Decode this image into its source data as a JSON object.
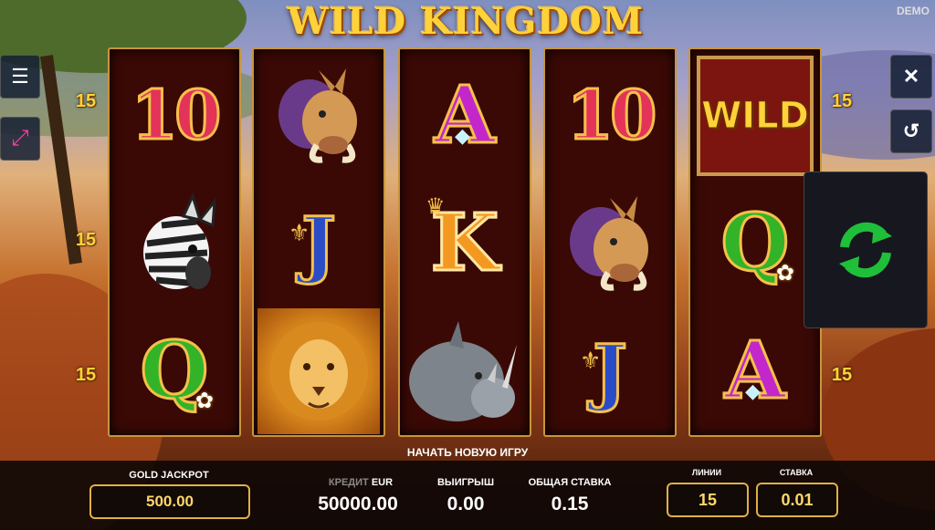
{
  "game": {
    "title": "WILD KINGDOM",
    "mode_badge": "DEMO"
  },
  "side_controls": {
    "left": [
      {
        "name": "menu-icon",
        "glyph": "☰"
      },
      {
        "name": "fullscreen-icon",
        "glyph": "⤢"
      }
    ],
    "right": [
      {
        "name": "close-icon",
        "glyph": "✕"
      },
      {
        "name": "history-icon",
        "glyph": "↺"
      }
    ]
  },
  "paylines": {
    "left": [
      "15",
      "15",
      "15"
    ],
    "right": [
      "15",
      "15"
    ]
  },
  "reels": [
    [
      {
        "sym": "10"
      },
      {
        "sym": "zebra"
      },
      {
        "sym": "Q"
      }
    ],
    [
      {
        "sym": "warthog"
      },
      {
        "sym": "J"
      },
      {
        "sym": "lion"
      }
    ],
    [
      {
        "sym": "A"
      },
      {
        "sym": "K"
      },
      {
        "sym": "rhino"
      }
    ],
    [
      {
        "sym": "10"
      },
      {
        "sym": "warthog"
      },
      {
        "sym": "J"
      }
    ],
    [
      {
        "sym": "WILD"
      },
      {
        "sym": "Q"
      },
      {
        "sym": "A"
      }
    ]
  ],
  "spin": {
    "icon": "spin-arrows-icon",
    "color": "#1fbf3a"
  },
  "new_game_label": "НАЧАТЬ НОВУЮ ИГРУ",
  "bottom_bar": {
    "jackpot_label": "GOLD JACKPOT",
    "jackpot_value": "500.00",
    "credit_label": "КРЕДИТ",
    "credit_currency": "EUR",
    "credit_value": "50000.00",
    "win_label": "ВЫИГРЫШ",
    "win_value": "0.00",
    "total_bet_label": "ОБЩАЯ СТАВКА",
    "total_bet_value": "0.15",
    "lines_label": "ЛИНИИ",
    "lines_value": "15",
    "bet_label": "СТАВКА",
    "bet_value": "0.01"
  },
  "colors": {
    "gold": "#ffd23a",
    "reel_bg": "#3a0905",
    "frame": "#c9953a"
  }
}
